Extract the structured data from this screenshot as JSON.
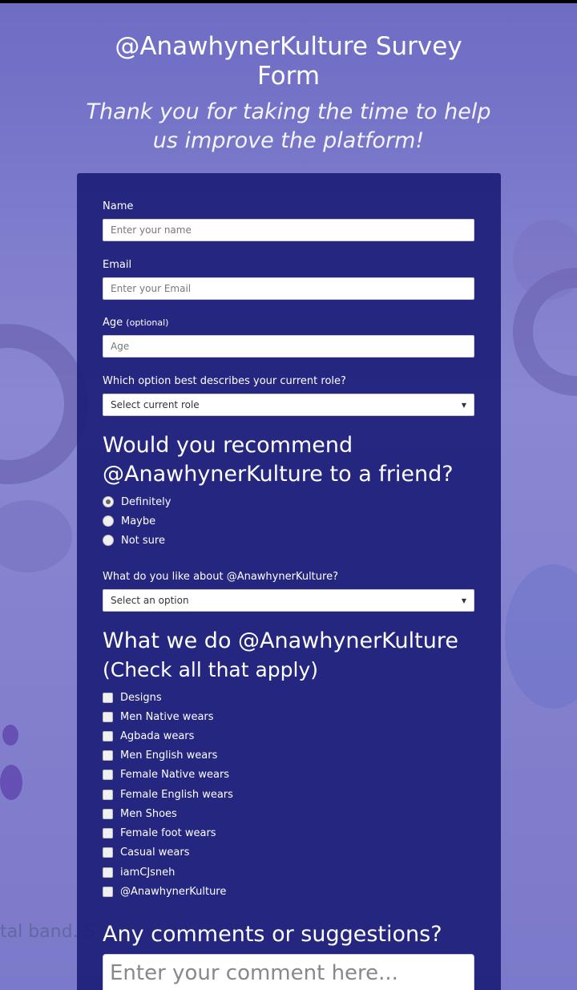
{
  "header": {
    "title": "@AnawhynerKulture Survey Form",
    "subtitle": "Thank you for taking the time to help us improve the platform!"
  },
  "background_text": "tal band. S",
  "form": {
    "name": {
      "label": "Name",
      "placeholder": "Enter your name"
    },
    "email": {
      "label": "Email",
      "placeholder": "Enter your Email"
    },
    "age": {
      "label": "Age",
      "optional": "(optional)",
      "placeholder": "Age"
    },
    "role": {
      "label": "Which option best describes your current role?",
      "value": "Select current role"
    },
    "recommend": {
      "heading": "Would you recommend @AnawhynerKulture to a friend?",
      "options": [
        "Definitely",
        "Maybe",
        "Not sure"
      ],
      "selected": "Definitely"
    },
    "like": {
      "label": "What do you like about @AnawhynerKulture?",
      "value": "Select an option"
    },
    "what_we_do": {
      "heading": "What we do @AnawhynerKulture",
      "subheading": "(Check all that apply)",
      "options": [
        "Designs",
        "Men Native wears",
        "Agbada wears",
        "Men English wears",
        "Female Native wears",
        "Female English wears",
        "Men Shoes",
        "Female foot wears",
        "Casual wears",
        "iamCJsneh",
        "@AnawhynerKulture"
      ]
    },
    "comments": {
      "heading": "Any comments or suggestions?",
      "placeholder": "Enter your comment here..."
    }
  },
  "colors": {
    "card": "#1c1e78",
    "background": "#7f7fc9"
  }
}
